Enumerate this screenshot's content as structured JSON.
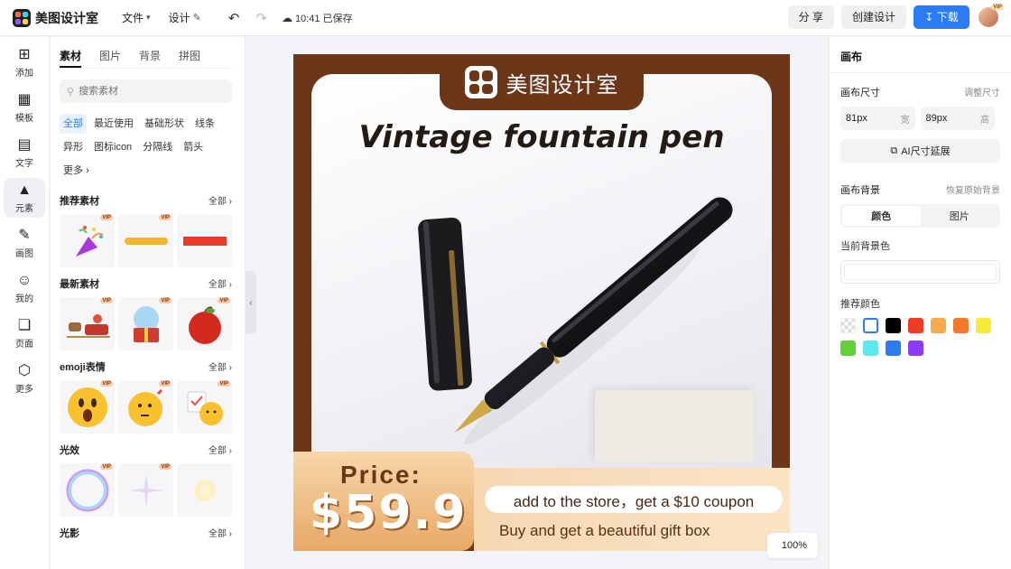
{
  "app": {
    "name": "美图设计室"
  },
  "topbar": {
    "file_menu": "文件",
    "design_menu": "设计",
    "saved_status": "10:41 已保存",
    "share_label": "分 享",
    "create_label": "创建设计",
    "download_label": "下载",
    "avatar_badge": "VIP"
  },
  "rail": {
    "items": [
      {
        "label": "添加",
        "icon": "plus-square-icon"
      },
      {
        "label": "模板",
        "icon": "template-icon"
      },
      {
        "label": "文字",
        "icon": "text-icon"
      },
      {
        "label": "元素",
        "icon": "element-icon"
      },
      {
        "label": "画图",
        "icon": "draw-icon"
      },
      {
        "label": "我的",
        "icon": "user-icon"
      },
      {
        "label": "页面",
        "icon": "page-icon"
      },
      {
        "label": "更多",
        "icon": "cube-icon"
      }
    ]
  },
  "panel": {
    "tabs": [
      "素材",
      "图片",
      "背景",
      "拼图"
    ],
    "search_placeholder": "搜索素材",
    "chips": [
      "全部",
      "最近使用",
      "基础形状",
      "线条",
      "异形",
      "图标icon",
      "分隔线",
      "箭头",
      "更多"
    ],
    "sections": [
      {
        "title": "推荐素材",
        "all": "全部"
      },
      {
        "title": "最新素材",
        "all": "全部"
      },
      {
        "title": "emoji表情",
        "all": "全部"
      },
      {
        "title": "光效",
        "all": "全部"
      },
      {
        "title": "光影",
        "all": "全部"
      }
    ],
    "vip": "VIP"
  },
  "canvas": {
    "brand": "美图设计室",
    "headline": "Vintage fountain pen",
    "price_label": "Price:",
    "price_value": "$59.9",
    "coupon_text": "add to the store，get a $10 coupon",
    "gift_text": "Buy and get a beautiful gift box",
    "background_color": "#6b3718",
    "zoom": "100%"
  },
  "right_panel": {
    "title": "画布",
    "size_label": "画布尺寸",
    "size_link": "调整尺寸",
    "width_value": "81px",
    "width_unit": "宽",
    "height_value": "89px",
    "height_unit": "高",
    "ai_button": "AI尺寸延展",
    "bg_label": "画布背景",
    "bg_reset": "恢复原始背景",
    "seg_color": "颜色",
    "seg_image": "图片",
    "current_bg": "当前背景色",
    "recommend": "推荐颜色",
    "swatches": [
      "transparent",
      "#ffffff",
      "#000000",
      "#ee3b27",
      "#f7a94b",
      "#f27a2a",
      "#f8ec3a",
      "#63cf3a",
      "#5de8ef",
      "#2c7bf1",
      "#8c3df2"
    ]
  }
}
